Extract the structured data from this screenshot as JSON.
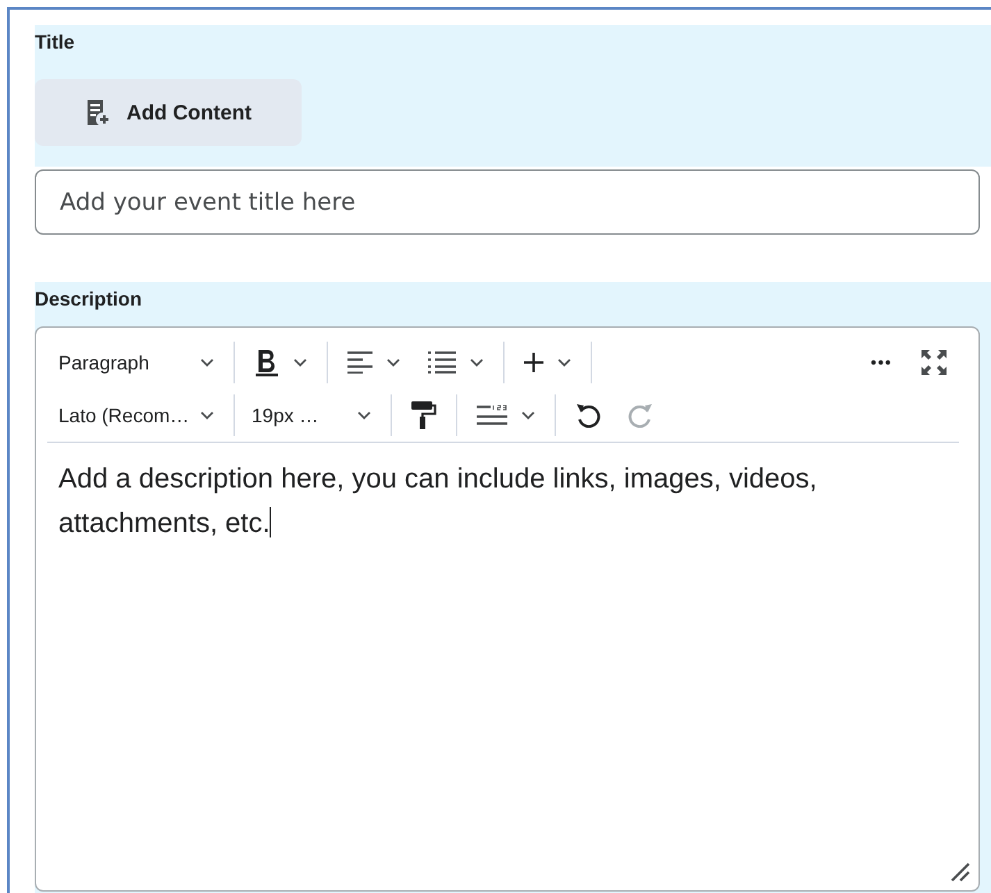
{
  "title_section": {
    "label": "Title",
    "add_button": "Add Content",
    "input": {
      "placeholder": "Add your event title here"
    }
  },
  "description_section": {
    "label": "Description",
    "toolbar": {
      "block_format": "Paragraph",
      "font": "Lato (Recom…",
      "size": "19px …",
      "more": "•••",
      "undo": {
        "disabled": false
      },
      "redo": {
        "disabled": true
      }
    },
    "content": "Add a description here, you can include links, images, videos, attachments, etc."
  }
}
